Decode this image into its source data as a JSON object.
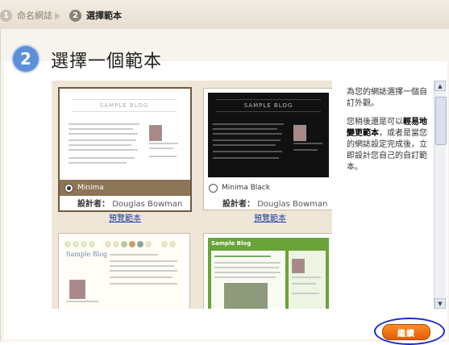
{
  "wizard": {
    "steps": [
      {
        "num": "1",
        "label": "命名網誌"
      },
      {
        "num": "2",
        "label": "選擇範本"
      }
    ]
  },
  "page": {
    "step_num": "2",
    "title": "選擇一個範本"
  },
  "templates": [
    {
      "thumb_title": "SAMPLE BLOG",
      "name": "Minima",
      "designer_label": "設計者：",
      "designer": "Douglas Bowman",
      "preview": "預覽範本",
      "selected": true
    },
    {
      "thumb_title": "SAMPLE BLOG",
      "name": "Minima Black",
      "designer_label": "設計者：",
      "designer": "Douglas Bowman",
      "preview": "預覽範本",
      "selected": false
    },
    {
      "thumb_title": "Sample Blog",
      "name": "",
      "selected": false
    },
    {
      "thumb_title": "Sample Blog",
      "name": "",
      "selected": false
    }
  ],
  "help": {
    "p1": "為您的網誌選擇一個自訂外觀。",
    "p2_pre": "您稍後還是可以",
    "p2_bold": "輕易地變更範本",
    "p2_post": "，或者是當您的網誌設定完成後，立即設計您自己的自訂範本。"
  },
  "continue_label": "繼續",
  "colors": {
    "accent": "#5d8fd9",
    "button": "#ff8d2b",
    "link": "#1a3f9e"
  }
}
